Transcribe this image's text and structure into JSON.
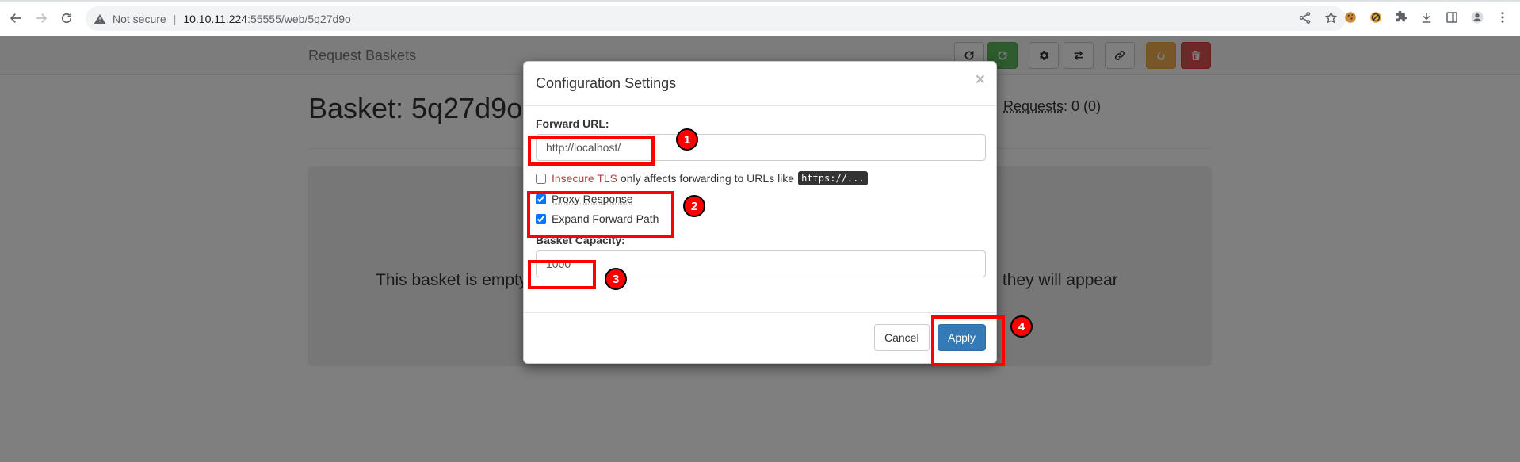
{
  "browser": {
    "not_secure": "Not secure",
    "url_host": "10.10.11.224",
    "url_rest": ":55555/web/5q27d9o"
  },
  "app": {
    "brand": "Request Baskets",
    "basket_title": "Basket: 5q27d9o",
    "requests_label": "Requests",
    "requests_value": ": 0 (0)",
    "empty_text_left": "This basket is empty",
    "empty_text_right": "and they will appear"
  },
  "modal": {
    "title": "Configuration Settings",
    "close": "×",
    "forward_url_label": "Forward URL:",
    "forward_url_value": "http://localhost/",
    "insecure_tls": "Insecure TLS",
    "insecure_tls_rest": "only affects forwarding to URLs like",
    "insecure_tls_code": "https://...",
    "insecure_tls_checked": false,
    "proxy_response": "Proxy Response",
    "proxy_response_checked": true,
    "expand_forward_path": "Expand Forward Path",
    "expand_forward_path_checked": true,
    "basket_capacity_label": "Basket Capacity:",
    "basket_capacity_value": "1000",
    "cancel": "Cancel",
    "apply": "Apply"
  },
  "annotations": {
    "color": "#ff0000",
    "labels": [
      "1",
      "2",
      "3",
      "4"
    ]
  },
  "colors": {
    "primary": "#337ab7",
    "success": "#5cb85c",
    "warning": "#f0ad4e",
    "danger": "#d9534f"
  }
}
